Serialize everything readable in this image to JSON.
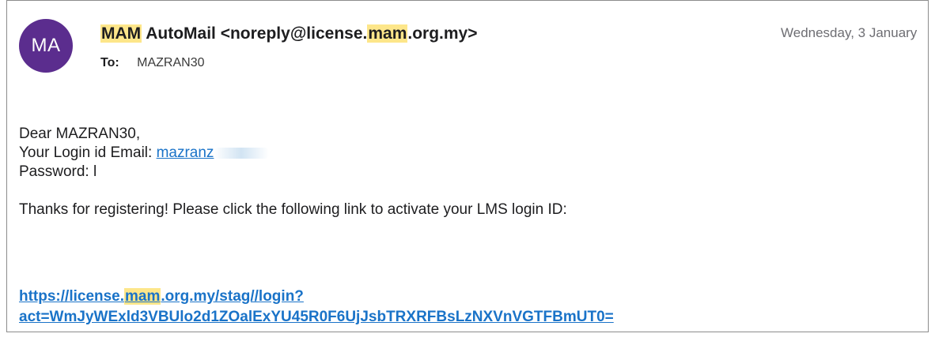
{
  "email": {
    "avatar_initials": "MA",
    "sender": {
      "name_hl": "MAM",
      "name_rest": " AutoMail <noreply@license.",
      "domain_hl": "mam",
      "domain_rest": ".org.my>"
    },
    "to_label": "To:",
    "to_value": "MAZRAN30",
    "date": "Wednesday, 3 January",
    "body": {
      "greeting": "Dear MAZRAN30,",
      "login_label": "Your Login id Email: ",
      "login_value": "mazranz",
      "password_label": "Password: ",
      "password_value": "l",
      "message": "Thanks for registering! Please click the following link to activate your LMS login ID:"
    },
    "activation_link": {
      "line1_pre": "https://license.",
      "line1_hl": "mam",
      "line1_post": ".org.my/stag//login?",
      "line2": "act=WmJyWExld3VBUlo2d1ZOalExYU45R0F6UjJsbTRXRFBsLzNXVnVGTFBmUT0="
    },
    "colors": {
      "avatar_bg": "#5b2d8e",
      "highlight": "#fde68a",
      "link": "#1a73c8"
    }
  }
}
